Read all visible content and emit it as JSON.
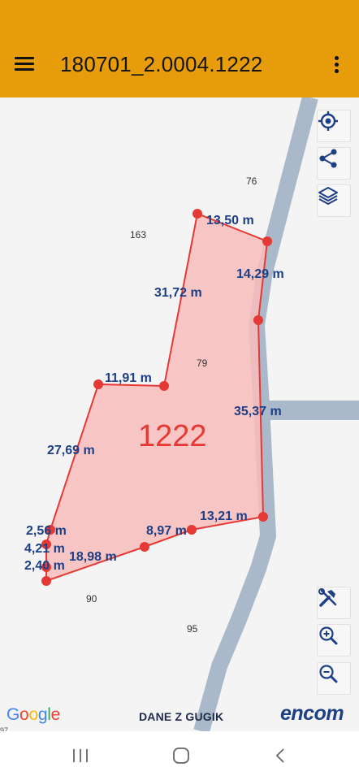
{
  "app_bar": {
    "title": "180701_2.0004.1222",
    "menu_icon": "hamburger-menu-icon",
    "more_icon": "more-vert-icon"
  },
  "colors": {
    "app_bar": "#e69c0b",
    "parcel_fill": "#f8bcbc",
    "parcel_stroke": "#e53935",
    "label_text": "#1d3f86",
    "parcel_number": "#e53935",
    "road": "#a9b9c9"
  },
  "map": {
    "parcel_number": "1222",
    "neighbor_parcels": [
      "76",
      "163",
      "79",
      "90",
      "95"
    ],
    "cut_label": "97",
    "edge_lengths": [
      "13,50 m",
      "14,29 m",
      "31,72 m",
      "11,91 m",
      "35,37 m",
      "27,69 m",
      "13,21 m",
      "8,97 m",
      "2,56 m",
      "4,21 m",
      "18,98 m",
      "2,40 m"
    ],
    "buttons": {
      "locate": "my-location-icon",
      "share": "share-icon",
      "layers": "layers-icon",
      "tools": "tools-icon",
      "zoom_in": "zoom-in-icon",
      "zoom_out": "zoom-out-icon"
    }
  },
  "footer": {
    "google_logo": "Google",
    "data_source": "DANE Z GUGIK",
    "brand": "encom"
  },
  "nav_bar": {
    "recents_icon": "recents-icon",
    "home_icon": "home-icon",
    "back_icon": "back-icon"
  }
}
